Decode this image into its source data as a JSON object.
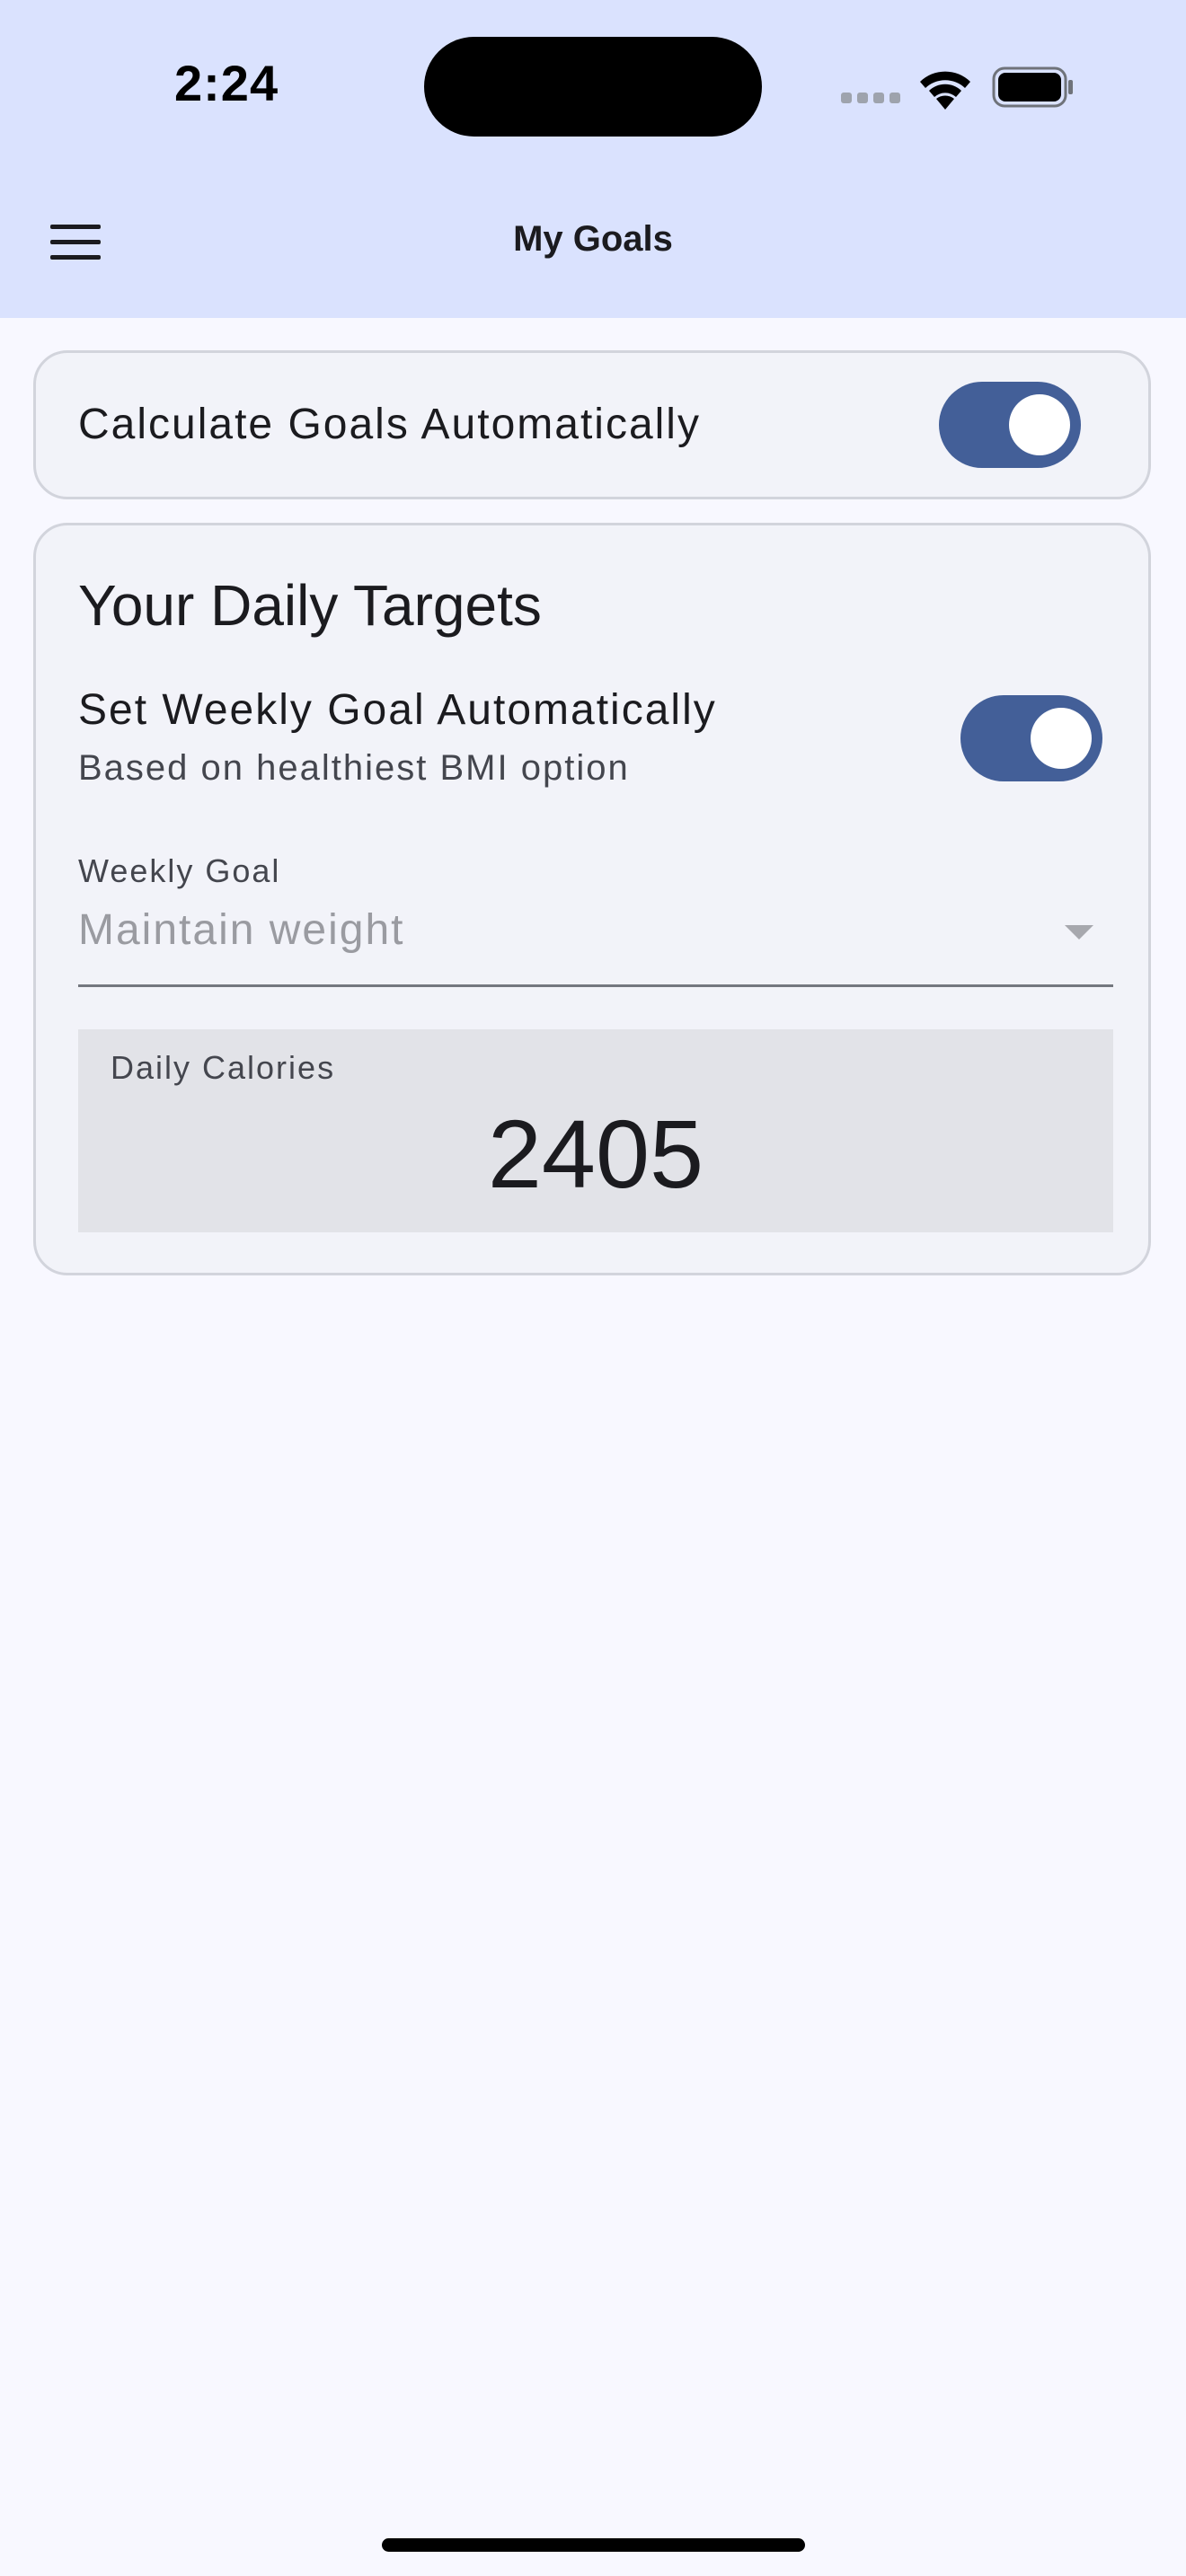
{
  "status_bar": {
    "time": "2:24",
    "icons": [
      "signal-icon",
      "wifi-icon",
      "battery-icon"
    ]
  },
  "app_bar": {
    "menu_icon": "menu-icon",
    "title": "My Goals"
  },
  "auto_goals": {
    "label": "Calculate Goals Automatically",
    "enabled": true
  },
  "daily_targets": {
    "title": "Your Daily Targets",
    "weekly_auto": {
      "title": "Set Weekly Goal Automatically",
      "subtitle": "Based on healthiest BMI option",
      "enabled": true
    },
    "weekly_goal": {
      "label": "Weekly Goal",
      "value": "Maintain weight"
    },
    "daily_calories": {
      "label": "Daily Calories",
      "value": "2405"
    }
  },
  "colors": {
    "app_bar_bg": "#dae2fe",
    "page_bg": "#f8f8ff",
    "card_bg": "#f2f3f9",
    "switch_on": "#435f98",
    "calories_bg": "#e2e3e8"
  }
}
